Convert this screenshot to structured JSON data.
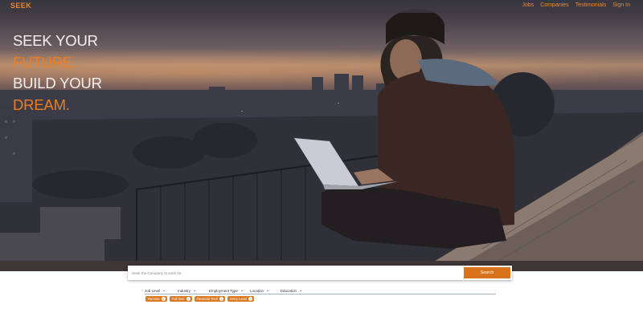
{
  "brand": "SEEK",
  "nav": {
    "items": [
      "Jobs",
      "Companies",
      "Testimonials",
      "Sign In"
    ]
  },
  "hero": {
    "line1": "SEEK YOUR",
    "line2": "FUTURE.",
    "line3": "BUILD YOUR",
    "line4": "DREAM."
  },
  "search": {
    "placeholder": "Seek the Company to work for",
    "button_label": "Search"
  },
  "filters": [
    "Job Level",
    "Industry",
    "Employment Type",
    "Location",
    "Education"
  ],
  "chips": [
    "Remote",
    "Full time",
    "Financial Tech",
    "Entry Level"
  ],
  "colors": {
    "accent": "#e9852a",
    "button": "#d8731c",
    "chip": "#d97a22"
  }
}
